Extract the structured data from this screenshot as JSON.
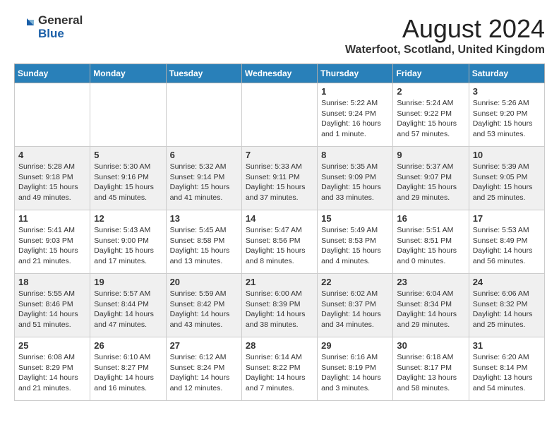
{
  "header": {
    "logo_line1": "General",
    "logo_line2": "Blue",
    "title": "August 2024",
    "subtitle": "Waterfoot, Scotland, United Kingdom"
  },
  "columns": [
    "Sunday",
    "Monday",
    "Tuesday",
    "Wednesday",
    "Thursday",
    "Friday",
    "Saturday"
  ],
  "weeks": [
    {
      "days": [
        {
          "num": "",
          "info": ""
        },
        {
          "num": "",
          "info": ""
        },
        {
          "num": "",
          "info": ""
        },
        {
          "num": "",
          "info": ""
        },
        {
          "num": "1",
          "info": "Sunrise: 5:22 AM\nSunset: 9:24 PM\nDaylight: 16 hours\nand 1 minute."
        },
        {
          "num": "2",
          "info": "Sunrise: 5:24 AM\nSunset: 9:22 PM\nDaylight: 15 hours\nand 57 minutes."
        },
        {
          "num": "3",
          "info": "Sunrise: 5:26 AM\nSunset: 9:20 PM\nDaylight: 15 hours\nand 53 minutes."
        }
      ]
    },
    {
      "days": [
        {
          "num": "4",
          "info": "Sunrise: 5:28 AM\nSunset: 9:18 PM\nDaylight: 15 hours\nand 49 minutes."
        },
        {
          "num": "5",
          "info": "Sunrise: 5:30 AM\nSunset: 9:16 PM\nDaylight: 15 hours\nand 45 minutes."
        },
        {
          "num": "6",
          "info": "Sunrise: 5:32 AM\nSunset: 9:14 PM\nDaylight: 15 hours\nand 41 minutes."
        },
        {
          "num": "7",
          "info": "Sunrise: 5:33 AM\nSunset: 9:11 PM\nDaylight: 15 hours\nand 37 minutes."
        },
        {
          "num": "8",
          "info": "Sunrise: 5:35 AM\nSunset: 9:09 PM\nDaylight: 15 hours\nand 33 minutes."
        },
        {
          "num": "9",
          "info": "Sunrise: 5:37 AM\nSunset: 9:07 PM\nDaylight: 15 hours\nand 29 minutes."
        },
        {
          "num": "10",
          "info": "Sunrise: 5:39 AM\nSunset: 9:05 PM\nDaylight: 15 hours\nand 25 minutes."
        }
      ]
    },
    {
      "days": [
        {
          "num": "11",
          "info": "Sunrise: 5:41 AM\nSunset: 9:03 PM\nDaylight: 15 hours\nand 21 minutes."
        },
        {
          "num": "12",
          "info": "Sunrise: 5:43 AM\nSunset: 9:00 PM\nDaylight: 15 hours\nand 17 minutes."
        },
        {
          "num": "13",
          "info": "Sunrise: 5:45 AM\nSunset: 8:58 PM\nDaylight: 15 hours\nand 13 minutes."
        },
        {
          "num": "14",
          "info": "Sunrise: 5:47 AM\nSunset: 8:56 PM\nDaylight: 15 hours\nand 8 minutes."
        },
        {
          "num": "15",
          "info": "Sunrise: 5:49 AM\nSunset: 8:53 PM\nDaylight: 15 hours\nand 4 minutes."
        },
        {
          "num": "16",
          "info": "Sunrise: 5:51 AM\nSunset: 8:51 PM\nDaylight: 15 hours\nand 0 minutes."
        },
        {
          "num": "17",
          "info": "Sunrise: 5:53 AM\nSunset: 8:49 PM\nDaylight: 14 hours\nand 56 minutes."
        }
      ]
    },
    {
      "days": [
        {
          "num": "18",
          "info": "Sunrise: 5:55 AM\nSunset: 8:46 PM\nDaylight: 14 hours\nand 51 minutes."
        },
        {
          "num": "19",
          "info": "Sunrise: 5:57 AM\nSunset: 8:44 PM\nDaylight: 14 hours\nand 47 minutes."
        },
        {
          "num": "20",
          "info": "Sunrise: 5:59 AM\nSunset: 8:42 PM\nDaylight: 14 hours\nand 43 minutes."
        },
        {
          "num": "21",
          "info": "Sunrise: 6:00 AM\nSunset: 8:39 PM\nDaylight: 14 hours\nand 38 minutes."
        },
        {
          "num": "22",
          "info": "Sunrise: 6:02 AM\nSunset: 8:37 PM\nDaylight: 14 hours\nand 34 minutes."
        },
        {
          "num": "23",
          "info": "Sunrise: 6:04 AM\nSunset: 8:34 PM\nDaylight: 14 hours\nand 29 minutes."
        },
        {
          "num": "24",
          "info": "Sunrise: 6:06 AM\nSunset: 8:32 PM\nDaylight: 14 hours\nand 25 minutes."
        }
      ]
    },
    {
      "days": [
        {
          "num": "25",
          "info": "Sunrise: 6:08 AM\nSunset: 8:29 PM\nDaylight: 14 hours\nand 21 minutes."
        },
        {
          "num": "26",
          "info": "Sunrise: 6:10 AM\nSunset: 8:27 PM\nDaylight: 14 hours\nand 16 minutes."
        },
        {
          "num": "27",
          "info": "Sunrise: 6:12 AM\nSunset: 8:24 PM\nDaylight: 14 hours\nand 12 minutes."
        },
        {
          "num": "28",
          "info": "Sunrise: 6:14 AM\nSunset: 8:22 PM\nDaylight: 14 hours\nand 7 minutes."
        },
        {
          "num": "29",
          "info": "Sunrise: 6:16 AM\nSunset: 8:19 PM\nDaylight: 14 hours\nand 3 minutes."
        },
        {
          "num": "30",
          "info": "Sunrise: 6:18 AM\nSunset: 8:17 PM\nDaylight: 13 hours\nand 58 minutes."
        },
        {
          "num": "31",
          "info": "Sunrise: 6:20 AM\nSunset: 8:14 PM\nDaylight: 13 hours\nand 54 minutes."
        }
      ]
    }
  ]
}
